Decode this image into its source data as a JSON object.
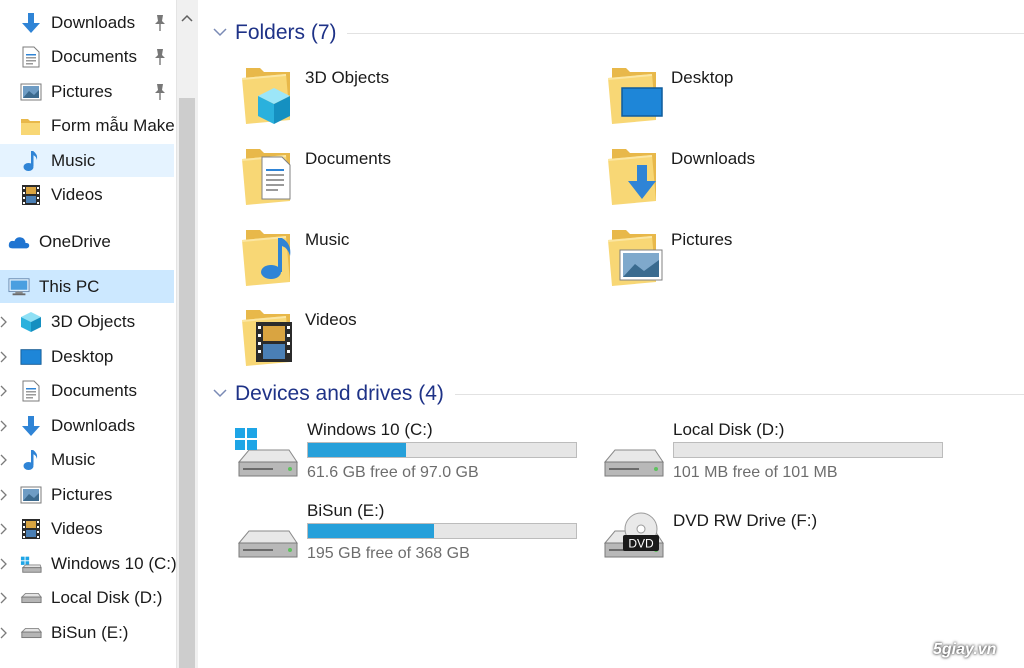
{
  "nav": {
    "quick_access": [
      {
        "label": "Downloads",
        "icon": "download-arrow-icon",
        "pinned": true
      },
      {
        "label": "Documents",
        "icon": "document-icon",
        "pinned": true
      },
      {
        "label": "Pictures",
        "icon": "pictures-icon",
        "pinned": true
      },
      {
        "label": "Form mẫu Make",
        "icon": "folder-icon",
        "pinned": false
      },
      {
        "label": "Music",
        "icon": "music-note-icon",
        "pinned": false
      },
      {
        "label": "Videos",
        "icon": "film-icon",
        "pinned": false
      }
    ],
    "onedrive": {
      "label": "OneDrive",
      "icon": "cloud-icon"
    },
    "this_pc": {
      "label": "This PC",
      "icon": "computer-icon"
    },
    "this_pc_children": [
      {
        "label": "3D Objects",
        "icon": "cube-icon"
      },
      {
        "label": "Desktop",
        "icon": "desktop-icon"
      },
      {
        "label": "Documents",
        "icon": "document-icon"
      },
      {
        "label": "Downloads",
        "icon": "download-arrow-icon"
      },
      {
        "label": "Music",
        "icon": "music-note-icon"
      },
      {
        "label": "Pictures",
        "icon": "pictures-icon"
      },
      {
        "label": "Videos",
        "icon": "film-icon"
      },
      {
        "label": "Windows 10 (C:)",
        "icon": "windows-drive-icon"
      },
      {
        "label": "Local Disk (D:)",
        "icon": "drive-icon"
      },
      {
        "label": "BiSun (E:)",
        "icon": "drive-icon"
      }
    ]
  },
  "folders": {
    "title": "Folders (7)",
    "items": [
      {
        "label": "3D Objects",
        "icon": "cube-folder-icon"
      },
      {
        "label": "Desktop",
        "icon": "desktop-folder-icon"
      },
      {
        "label": "Documents",
        "icon": "documents-folder-icon"
      },
      {
        "label": "Downloads",
        "icon": "downloads-folder-icon"
      },
      {
        "label": "Music",
        "icon": "music-folder-icon"
      },
      {
        "label": "Pictures",
        "icon": "pictures-folder-icon"
      },
      {
        "label": "Videos",
        "icon": "videos-folder-icon"
      }
    ]
  },
  "drives": {
    "title": "Devices and drives (4)",
    "items": [
      {
        "label": "Windows 10 (C:)",
        "free_text": "61.6 GB free of 97.0 GB",
        "used_fraction": 0.365,
        "icon": "windows-drive-icon",
        "has_bar": true
      },
      {
        "label": "Local Disk (D:)",
        "free_text": "101 MB free of 101 MB",
        "used_fraction": 0.0,
        "icon": "drive-icon",
        "has_bar": true
      },
      {
        "label": "BiSun (E:)",
        "free_text": "195 GB free of 368 GB",
        "used_fraction": 0.47,
        "icon": "drive-icon",
        "has_bar": true
      },
      {
        "label": "DVD RW Drive (F:)",
        "icon": "dvd-drive-icon",
        "has_bar": false,
        "badge": "DVD"
      }
    ]
  },
  "watermark": "5giay.vn",
  "colors": {
    "selection": "#cce8ff",
    "hover": "#e5f3ff",
    "group_title": "#1e3287",
    "bar_fill": "#26a0da",
    "folder": "#f8d775"
  }
}
